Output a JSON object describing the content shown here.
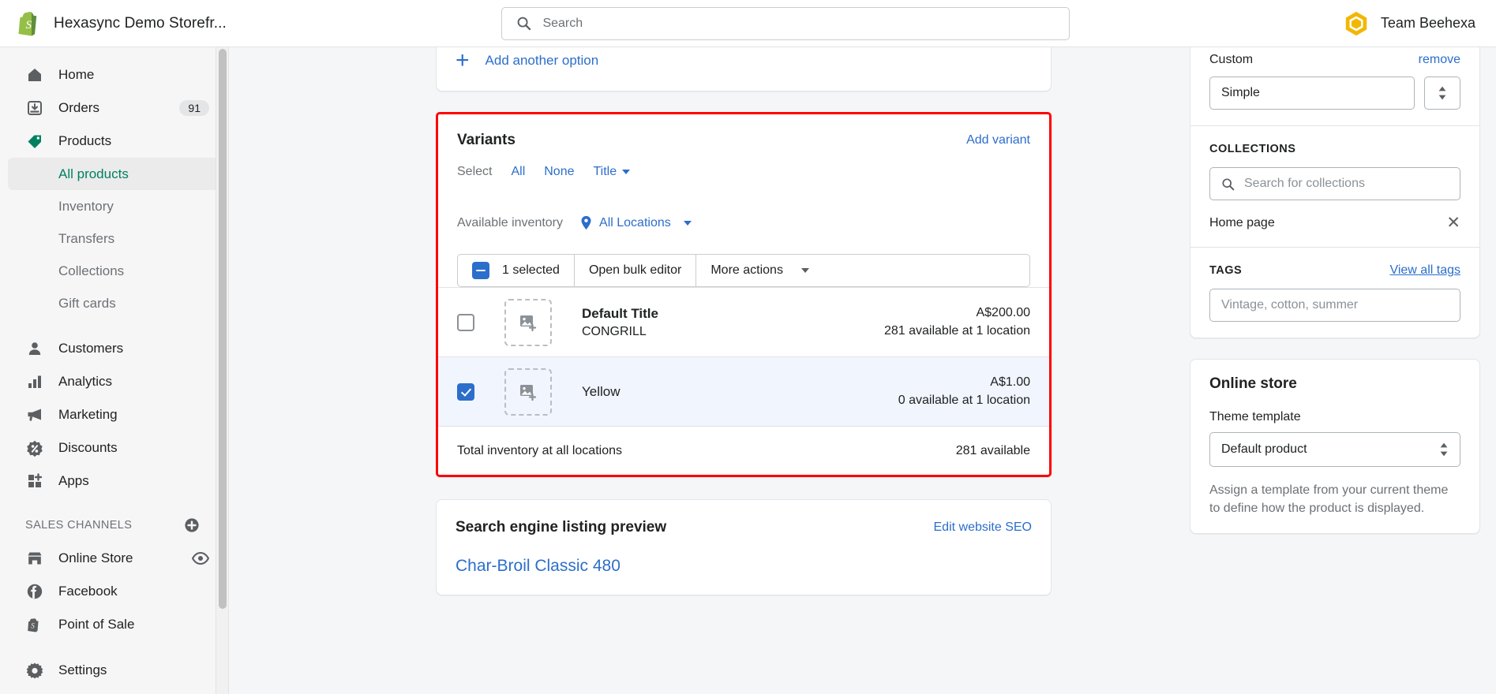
{
  "topbar": {
    "store_name": "Hexasync Demo Storefr...",
    "logo_icon": "shopify-bag-icon",
    "search_placeholder": "Search",
    "search_icon": "search-icon",
    "account_name": "Team Beehexa",
    "account_logo_icon": "hexagon-logo-icon"
  },
  "sidebar": {
    "items": [
      {
        "label": "Home",
        "icon": "home-icon",
        "badge": ""
      },
      {
        "label": "Orders",
        "icon": "orders-inbox-icon",
        "badge": "91"
      },
      {
        "label": "Products",
        "icon": "products-tag-icon",
        "badge": ""
      }
    ],
    "product_subitems": [
      {
        "label": "All products",
        "active": true
      },
      {
        "label": "Inventory",
        "active": false
      },
      {
        "label": "Transfers",
        "active": false
      },
      {
        "label": "Collections",
        "active": false
      },
      {
        "label": "Gift cards",
        "active": false
      }
    ],
    "items2": [
      {
        "label": "Customers",
        "icon": "customers-person-icon"
      },
      {
        "label": "Analytics",
        "icon": "analytics-bars-icon"
      },
      {
        "label": "Marketing",
        "icon": "marketing-megaphone-icon"
      },
      {
        "label": "Discounts",
        "icon": "discounts-percent-icon"
      },
      {
        "label": "Apps",
        "icon": "apps-grid-plus-icon"
      }
    ],
    "sales_channels_header": "SALES CHANNELS",
    "sales_channels_add_icon": "plus-circle-icon",
    "channels": [
      {
        "label": "Online Store",
        "icon": "storefront-icon",
        "trailing_icon": "eye-icon"
      },
      {
        "label": "Facebook",
        "icon": "facebook-icon",
        "trailing_icon": ""
      },
      {
        "label": "Point of Sale",
        "icon": "point-of-sale-icon",
        "trailing_icon": ""
      }
    ],
    "settings": {
      "label": "Settings",
      "icon": "gear-icon"
    }
  },
  "main": {
    "add_option": {
      "label": "Add another option",
      "icon": "plus-icon"
    },
    "variants": {
      "title": "Variants",
      "add_variant_label": "Add variant",
      "select_label": "Select",
      "select_all_label": "All",
      "select_none_label": "None",
      "sort_label": "Title",
      "available_inventory_label": "Available inventory",
      "location_label": "All Locations",
      "location_icon": "map-pin-icon",
      "bulk": {
        "selected_label": "1 selected",
        "bulk_editor_label": "Open bulk editor",
        "more_actions_label": "More actions",
        "checkbox_state": "indeterminate"
      },
      "rows": [
        {
          "title": "Default Title",
          "sku": "CONGRILL",
          "price": "A$200.00",
          "inventory": "281 available at 1 location",
          "checked": false,
          "thumb_icon": "add-image-icon"
        },
        {
          "title": "Yellow",
          "sku": "",
          "price": "A$1.00",
          "inventory": "0 available at 1 location",
          "checked": true,
          "thumb_icon": "add-image-icon"
        }
      ],
      "total_label": "Total inventory at all locations",
      "total_value": "281 available"
    },
    "seo": {
      "title": "Search engine listing preview",
      "edit_label": "Edit website SEO",
      "preview_title": "Char-Broil Classic 480"
    }
  },
  "right": {
    "product_type": {
      "label": "Custom",
      "remove_label": "remove",
      "value": "Simple",
      "stepper_icon": "up-down-arrows-icon"
    },
    "collections": {
      "header": "COLLECTIONS",
      "search_placeholder": "Search for collections",
      "search_icon": "search-icon",
      "chips": [
        {
          "label": "Home page",
          "remove_icon": "close-icon"
        }
      ]
    },
    "tags": {
      "header": "TAGS",
      "view_all_label": "View all tags",
      "placeholder": "Vintage, cotton, summer"
    },
    "online_store": {
      "title": "Online store",
      "theme_label": "Theme template",
      "theme_value": "Default product",
      "theme_icon": "select-chevrons-icon",
      "helper_text": "Assign a template from your current theme to define how the product is displayed."
    }
  },
  "colors": {
    "accent_blue": "#2c6ecb",
    "brand_green": "#008060",
    "highlight_red": "#ff0000",
    "selected_row_bg": "#f1f5fe"
  }
}
